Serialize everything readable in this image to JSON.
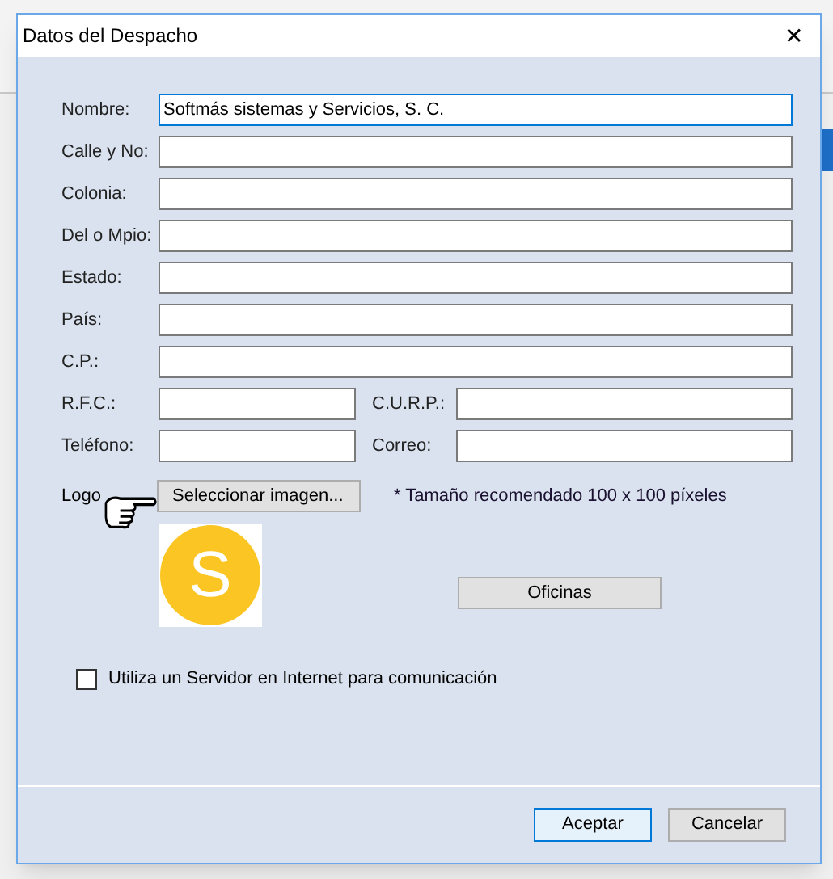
{
  "dialog": {
    "title": "Datos del Despacho",
    "close": "✕"
  },
  "rows": [
    {
      "fields": [
        {
          "label": "Nombre:",
          "value": "Softmás sistemas y Servicios, S. C.",
          "focused": true
        }
      ]
    },
    {
      "fields": [
        {
          "label": "Calle y No:",
          "focused": false
        }
      ]
    },
    {
      "fields": [
        {
          "label": "Colonia:",
          "focused": false
        }
      ]
    },
    {
      "fields": [
        {
          "label": "Del o Mpio:",
          "focused": false
        }
      ]
    },
    {
      "fields": [
        {
          "label": "Estado:",
          "focused": false
        }
      ]
    },
    {
      "fields": [
        {
          "label": "País:",
          "focused": false
        }
      ]
    },
    {
      "fields": [
        {
          "label": "C.P.:",
          "focused": false
        }
      ]
    },
    {
      "fields": [
        {
          "label": "R.F.C.:",
          "focused": false
        },
        {
          "label": "C.U.R.P.:",
          "focused": false
        }
      ]
    },
    {
      "fields": [
        {
          "label": "Teléfono:",
          "focused": false
        },
        {
          "label": "Correo:",
          "focused": false
        }
      ]
    }
  ],
  "logo": {
    "label": "Logo",
    "button": "Seleccionar imagen...",
    "note": "* Tamaño recomendado 100 x 100 píxeles",
    "letter": "S"
  },
  "offices_button": "Oficinas",
  "internet_server": {
    "label": "Utiliza un Servidor en Internet para comunicación",
    "checked": false
  },
  "buttons": [
    {
      "label": "Aceptar",
      "default": true
    },
    {
      "label": "Cancelar",
      "default": false
    }
  ]
}
